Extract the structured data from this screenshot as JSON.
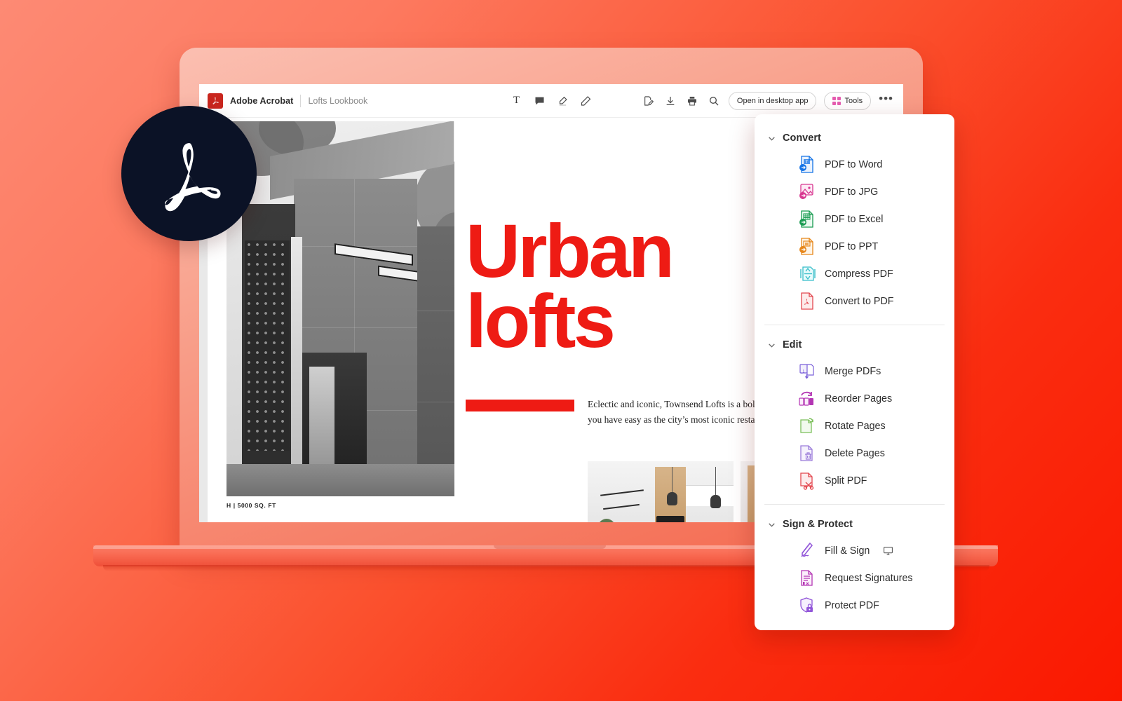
{
  "brand": {
    "accent_red": "#ee1b14",
    "badge_navy": "#0b1226",
    "bg_gradient_from": "#fd8a74",
    "bg_gradient_to": "#fa1800",
    "acrobat_logo_alt": "acrobat-logo"
  },
  "toolbar": {
    "app_name": "Adobe Acrobat",
    "doc_title": "Lofts Lookbook",
    "annotate_tools": [
      {
        "name": "add-text-icon",
        "glyph": "T"
      },
      {
        "name": "add-comment-icon",
        "glyph": "comment"
      },
      {
        "name": "highlight-icon",
        "glyph": "highlighter"
      },
      {
        "name": "draw-icon",
        "glyph": "pen"
      }
    ],
    "actions": [
      {
        "name": "fill-and-sign-icon",
        "glyph": "sign"
      },
      {
        "name": "download-icon",
        "glyph": "download"
      },
      {
        "name": "print-icon",
        "glyph": "print"
      },
      {
        "name": "search-icon",
        "glyph": "search"
      }
    ],
    "open_desktop_label": "Open in desktop app",
    "tools_label": "Tools",
    "more_label": "•••"
  },
  "document": {
    "headline": "Urban\nlofts",
    "body_copy": "Eclectic and iconic, Townsend Lofts is a bold located at the heart of the city, you have easy as the city’s most iconic restaurants and nightl",
    "photo_caption": "H | 5000 SQ. FT"
  },
  "tools_panel": {
    "sections": [
      {
        "title": "Convert",
        "name": "convert",
        "items": [
          {
            "label": "PDF to Word",
            "icon": "pdf-to-word-icon",
            "color": "#1473e6"
          },
          {
            "label": "PDF to JPG",
            "icon": "pdf-to-jpg-icon",
            "color": "#d83790"
          },
          {
            "label": "PDF to Excel",
            "icon": "pdf-to-excel-icon",
            "color": "#1a9c52"
          },
          {
            "label": "PDF to PPT",
            "icon": "pdf-to-ppt-icon",
            "color": "#e68619"
          },
          {
            "label": "Compress PDF",
            "icon": "compress-pdf-icon",
            "color": "#38bec9"
          },
          {
            "label": "Convert to PDF",
            "icon": "convert-to-pdf-icon",
            "color": "#e34850"
          }
        ]
      },
      {
        "title": "Edit",
        "name": "edit",
        "items": [
          {
            "label": "Merge PDFs",
            "icon": "merge-pdfs-icon",
            "color": "#7b61d9"
          },
          {
            "label": "Reorder Pages",
            "icon": "reorder-pages-icon",
            "color": "#b335b3"
          },
          {
            "label": "Rotate Pages",
            "icon": "rotate-pages-icon",
            "color": "#7bbf5a"
          },
          {
            "label": "Delete Pages",
            "icon": "delete-pages-icon",
            "color": "#9a7bd9"
          },
          {
            "label": "Split PDF",
            "icon": "split-pdf-icon",
            "color": "#e34850"
          }
        ]
      },
      {
        "title": "Sign & Protect",
        "name": "sign-and-protect",
        "items": [
          {
            "label": "Fill & Sign",
            "icon": "fill-and-sign-icon",
            "color": "#9256d9",
            "trailing_icon": "desktop-monitor-icon"
          },
          {
            "label": "Request Signatures",
            "icon": "request-signatures-icon",
            "color": "#b335b3"
          },
          {
            "label": "Protect PDF",
            "icon": "protect-pdf-icon",
            "color": "#9256d9"
          }
        ]
      }
    ]
  }
}
